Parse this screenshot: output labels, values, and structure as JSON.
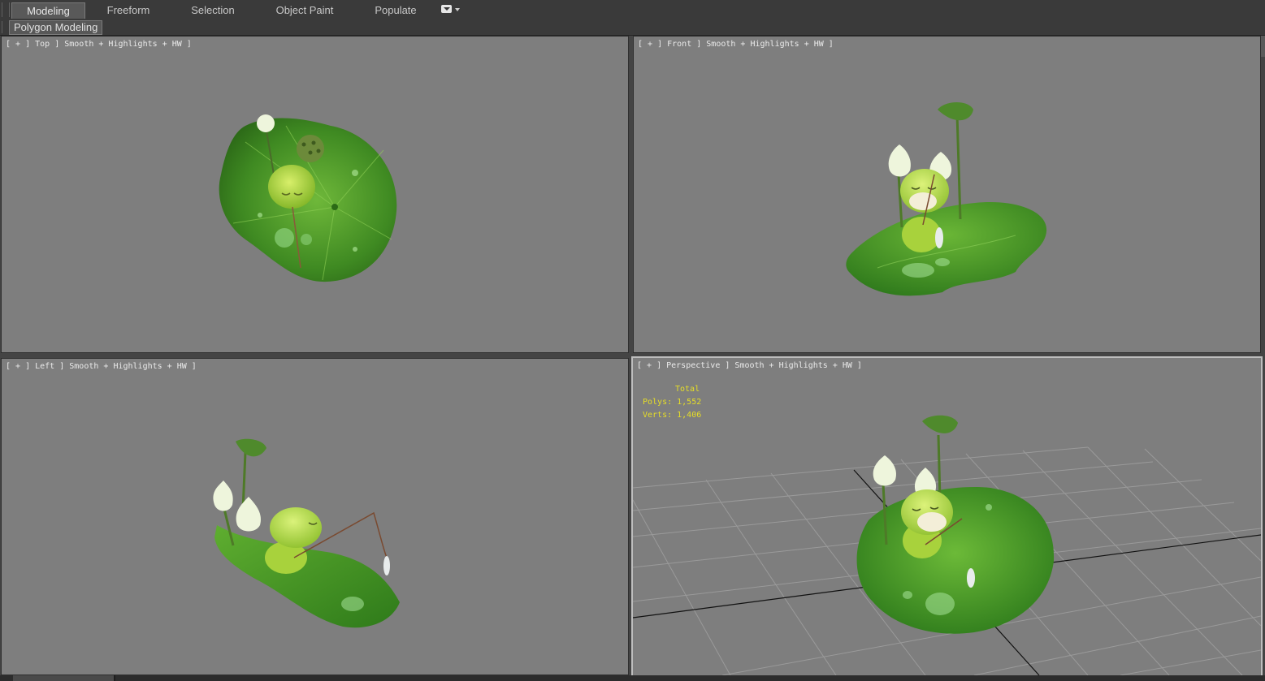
{
  "ribbon": {
    "tabs": [
      {
        "label": "Modeling",
        "active": true
      },
      {
        "label": "Freeform",
        "active": false
      },
      {
        "label": "Selection",
        "active": false
      },
      {
        "label": "Object Paint",
        "active": false
      },
      {
        "label": "Populate",
        "active": false
      }
    ],
    "menu_icon": "dropdown-menu-icon"
  },
  "subbar": {
    "label": "Polygon Modeling"
  },
  "viewports": {
    "top": {
      "label": "[ + ] Top ] Smooth + Highlights + HW ]"
    },
    "front": {
      "label": "[ + ] Front ] Smooth + Highlights + HW ]"
    },
    "left": {
      "label": "[ + ] Left ] Smooth + Highlights + HW ]"
    },
    "perspective": {
      "label": "[ + ] Perspective ] Smooth + Highlights + HW ]",
      "stats": {
        "total": "Total",
        "polys": "Polys: 1,552",
        "verts": "Verts: 1,406"
      }
    }
  },
  "colors": {
    "viewport_bg": "#7e7e7e",
    "stats_text": "#e6de27",
    "leaf": "#4f9a2a",
    "frog": "#a9d23b"
  }
}
